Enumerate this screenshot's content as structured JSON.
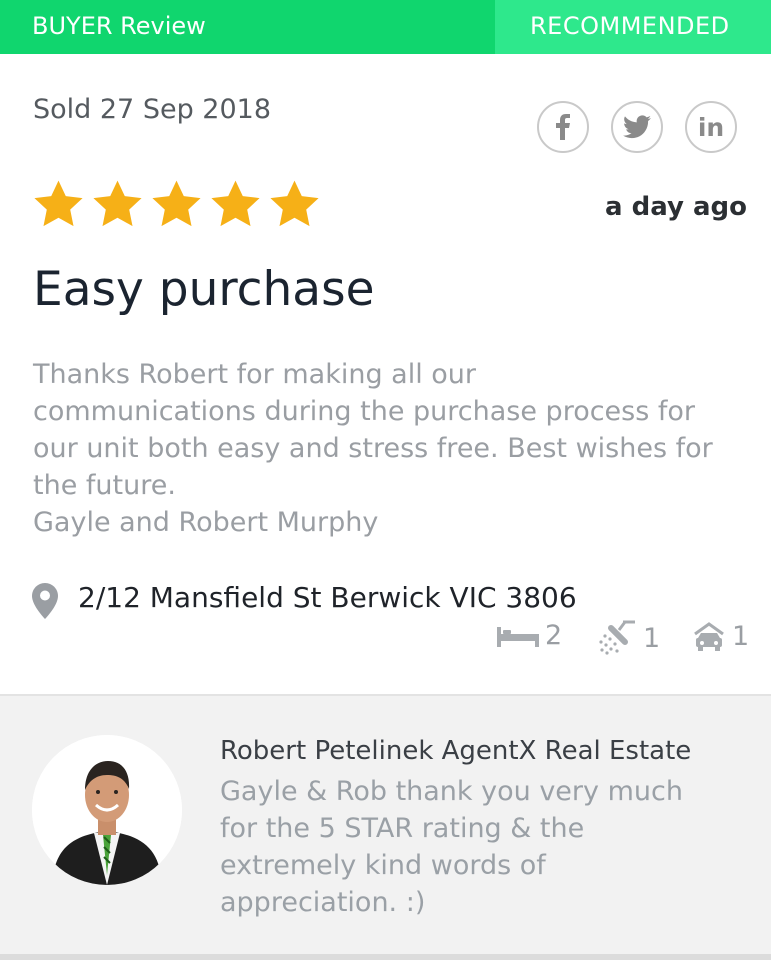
{
  "header": {
    "left_label": "BUYER Review",
    "right_label": "RECOMMENDED",
    "left_color": "#10d66e",
    "right_color": "#2ee88c"
  },
  "review": {
    "sold_label": "Sold 27 Sep 2018",
    "rating": 5,
    "rating_max": 5,
    "star_color": "#f6b017",
    "posted": "a day ago",
    "title": "Easy purchase",
    "body_lines": [
      "Thanks Robert for making all our",
      "communications during the purchase process for",
      "our unit both easy and stress free. Best wishes for",
      "the future.",
      "Gayle and Robert Murphy"
    ]
  },
  "share": {
    "icons": [
      "facebook-icon",
      "twitter-icon",
      "linkedin-icon"
    ],
    "linkedin_label": "in"
  },
  "property": {
    "address": "2/12 Mansfield St Berwick VIC 3806",
    "bedrooms": "2",
    "bathrooms": "1",
    "car_spaces": "1"
  },
  "agent_reply": {
    "name": "Robert Petelinek AgentX Real Estate",
    "text_lines": [
      "Gayle & Rob thank you very much",
      "for the 5 STAR rating & the",
      "extremely kind words of",
      "appreciation. :)"
    ]
  }
}
